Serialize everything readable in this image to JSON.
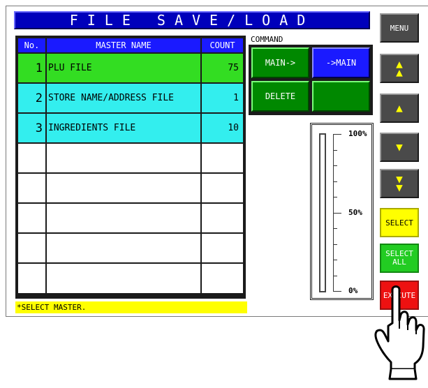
{
  "title": "FILE SAVE/LOAD",
  "table": {
    "headers": {
      "no": "No.",
      "name": "MASTER NAME",
      "count": "COUNT"
    },
    "rows": [
      {
        "no": "1",
        "name": "PLU FILE",
        "count": "75"
      },
      {
        "no": "2",
        "name": "STORE NAME/ADDRESS FILE",
        "count": "1"
      },
      {
        "no": "3",
        "name": "INGREDIENTS FILE",
        "count": "10"
      }
    ]
  },
  "command": {
    "label": "COMMAND",
    "main_to": "MAIN->",
    "to_main": "->MAIN",
    "delete": "DELETE"
  },
  "gauge": {
    "top": "100%",
    "mid": "50%",
    "bottom": "0%",
    "level_percent": 0
  },
  "status": "*SELECT MASTER.",
  "buttons": {
    "menu": "MENU",
    "page_up_icon": "double-up-arrow",
    "up_icon": "up-arrow",
    "down_icon": "down-arrow",
    "page_down_icon": "double-down-arrow",
    "select": "SELECT",
    "select_all_1": "SELECT",
    "select_all_2": "ALL",
    "execute": "EXECUTE"
  },
  "colors": {
    "title_bg": "#0000bb",
    "selected_row": "#33dd22",
    "row": "#33eeee",
    "execute": "#ee1111"
  }
}
